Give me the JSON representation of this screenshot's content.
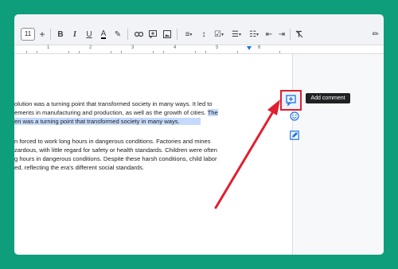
{
  "toolbar": {
    "font_size": "11",
    "buttons": [
      {
        "name": "increase-font-size-icon",
        "glyph": "+"
      },
      {
        "name": "bold-icon",
        "glyph": "B"
      },
      {
        "name": "italic-icon",
        "glyph": "I"
      },
      {
        "name": "underline-icon",
        "glyph": "U"
      },
      {
        "name": "text-color-icon",
        "glyph": "A"
      },
      {
        "name": "highlight-color-icon",
        "glyph": "✎"
      },
      {
        "name": "insert-link-icon",
        "glyph": "⛓"
      },
      {
        "name": "add-comment-toolbar-icon",
        "glyph": "⊞"
      },
      {
        "name": "insert-image-icon",
        "glyph": "▣"
      },
      {
        "name": "align-icon",
        "glyph": "≡"
      },
      {
        "name": "line-spacing-icon",
        "glyph": "↕"
      },
      {
        "name": "checklist-icon",
        "glyph": "☑"
      },
      {
        "name": "bulleted-list-icon",
        "glyph": "☰"
      },
      {
        "name": "numbered-list-icon",
        "glyph": "⒈"
      },
      {
        "name": "decrease-indent-icon",
        "glyph": "⇤"
      },
      {
        "name": "increase-indent-icon",
        "glyph": "⇥"
      },
      {
        "name": "clear-formatting-icon",
        "glyph": "T̸"
      },
      {
        "name": "edit-mode-icon",
        "glyph": "✏"
      }
    ]
  },
  "ruler": {
    "numbers": [
      "1",
      "2",
      "3",
      "4",
      "5",
      "6"
    ]
  },
  "document": {
    "paragraph1": [
      {
        "text": "olution was a turning point that transformed society in many ways. It led to",
        "highlight": ""
      },
      {
        "text": "ements in manufacturing and production, as well as the growth of cities. ",
        "highlight": "The"
      },
      {
        "text": "",
        "highlight": "en was a turning point that transformed society in many ways."
      }
    ],
    "paragraph2": [
      "n forced to work long hours in dangerous conditions. Factories and mines",
      "zardous, with little regard for safety or health standards. Children were often",
      "g hours in dangerous conditions. Despite these harsh conditions, child labor",
      "ed, reflecting the era's different social standards."
    ]
  },
  "side_actions": {
    "add_comment_tooltip": "Add comment",
    "icons": [
      "add-comment-icon",
      "add-emoji-reaction-icon",
      "suggest-edits-icon"
    ]
  },
  "colors": {
    "background": "#0f9e7b",
    "selection": "#c5dafc",
    "annotation_red": "#e11f2e",
    "accent_blue": "#1a73e8"
  }
}
